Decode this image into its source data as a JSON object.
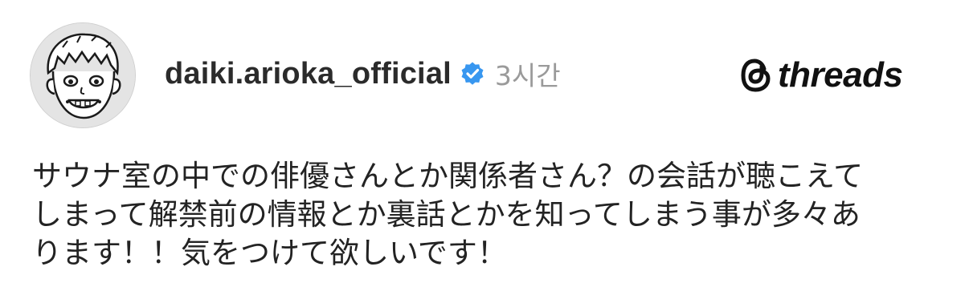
{
  "post": {
    "username": "daiki.arioka_official",
    "verified_icon": "verified-badge-icon",
    "timestamp": "3시간",
    "body_lines": [
      "サウナ室の中での俳優さんとか関係者さん？の会話が聴こえて",
      "しまって解禁前の情報とか裏話とかを知ってしまう事が多々あ",
      "ります！！気をつけて欲しいです！"
    ]
  },
  "brand": {
    "name": "threads",
    "icon": "threads-logo-icon"
  },
  "avatar": {
    "icon": "cartoon-face-avatar"
  },
  "colors": {
    "verified": "#3897f0",
    "timestamp": "#9a9a9a",
    "text": "#232323"
  }
}
